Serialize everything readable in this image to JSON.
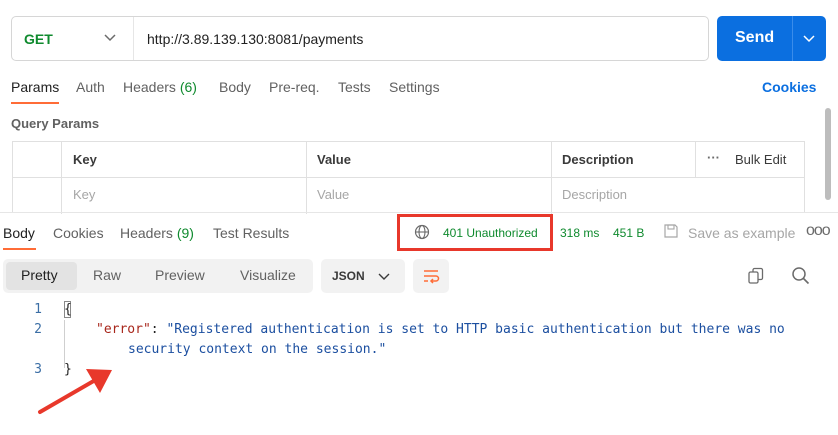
{
  "request": {
    "method": "GET",
    "url": "http://3.89.139.130:8081/payments",
    "send_label": "Send"
  },
  "request_tabs": {
    "params": "Params",
    "auth": "Auth",
    "headers": "Headers",
    "headers_count": "(6)",
    "body": "Body",
    "prereq": "Pre-req.",
    "tests": "Tests",
    "settings": "Settings",
    "cookies": "Cookies"
  },
  "query_params": {
    "title": "Query Params",
    "columns": [
      "Key",
      "Value",
      "Description"
    ],
    "bulk_edit": "Bulk Edit",
    "placeholders": [
      "Key",
      "Value",
      "Description"
    ]
  },
  "response_tabs": {
    "body": "Body",
    "cookies": "Cookies",
    "headers": "Headers",
    "headers_count": "(9)",
    "test_results": "Test Results"
  },
  "response_meta": {
    "status": "401 Unauthorized",
    "time": "318 ms",
    "size": "451 B",
    "save_example": "Save as example",
    "more": "ooo"
  },
  "format": {
    "modes": [
      "Pretty",
      "Raw",
      "Preview",
      "Visualize"
    ],
    "language": "JSON"
  },
  "code": {
    "line_numbers": [
      "1",
      "2",
      "3"
    ],
    "open_brace": "{",
    "key": "\"error\"",
    "colon": ": ",
    "value_part1": "\"Registered authentication is set to HTTP basic authentication but there was no",
    "value_part2": "security context on the session.\"",
    "close_brace": "}"
  },
  "colors": {
    "accent": "#ff6c37",
    "send": "#0b6fe0",
    "success_green": "#0f8a2e",
    "annotation_red": "#e8382b"
  }
}
